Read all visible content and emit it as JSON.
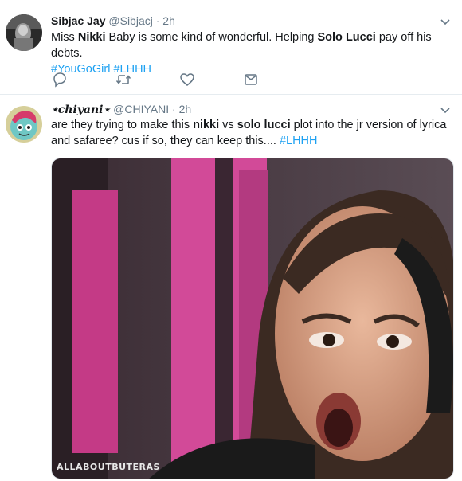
{
  "tweets": [
    {
      "display_name": "Sibjac Jay",
      "handle": "@Sibjacj",
      "dot": "·",
      "time": "2h",
      "text_parts": [
        "Miss ",
        "Nikki",
        " Baby is some kind of wonderful. Helping ",
        "Solo Lucci",
        " pay off his debts."
      ],
      "hashtags": [
        "#YouGoGirl",
        "#LHHH"
      ]
    },
    {
      "display_name": "⋆chiyani⋆",
      "handle": "@CHIYANI",
      "dot": "·",
      "time": "2h",
      "text_parts": [
        "are they trying to make this ",
        "nikki",
        " vs ",
        "solo lucci",
        " plot into the jr version of lyrica and safaree? cus if so, they can keep this.... "
      ],
      "hashtags": [
        "#LHHH"
      ],
      "media": {
        "watermark": "ALLABOUTBUTERAS"
      }
    }
  ],
  "icons": {
    "reply": "reply-icon",
    "retweet": "retweet-icon",
    "like": "like-icon",
    "message": "direct-message-icon",
    "caret": "chevron-down-icon"
  },
  "colors": {
    "hashtag": "#1da1f2",
    "secondary_text": "#657786",
    "divider": "#e6ecf0"
  }
}
